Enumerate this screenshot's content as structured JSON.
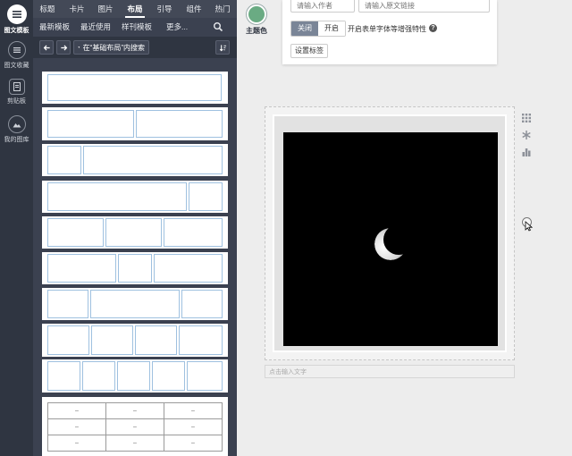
{
  "rail": {
    "items": [
      {
        "label": "图文模板",
        "icon": "menu-icon",
        "active": true
      },
      {
        "label": "图文收藏",
        "icon": "list-icon",
        "active": false
      },
      {
        "label": "剪贴板",
        "icon": "clipboard-icon",
        "active": false
      },
      {
        "label": "我的图库",
        "icon": "image-icon",
        "active": false
      }
    ]
  },
  "topnav": {
    "tabs": [
      "标题",
      "卡片",
      "图片",
      "布局",
      "引导",
      "组件",
      "热门"
    ],
    "active": "布局"
  },
  "subnav": {
    "tabs": [
      "最新模板",
      "最近使用",
      "样刊模板",
      "更多..."
    ]
  },
  "toolbar": {
    "search_label": "在“基础布局”内搜索"
  },
  "table_template": {
    "cells": [
      "–",
      "–",
      "–",
      "–",
      "–",
      "–",
      "–",
      "–",
      "–"
    ]
  },
  "theme": {
    "label": "主题色",
    "color": "#6aab83"
  },
  "settings": {
    "author_placeholder": "请输入作者",
    "link_placeholder": "请输入原文链接",
    "toggle_off": "关闭",
    "toggle_on": "开启",
    "option_label": "开启表单字体等增强特性",
    "tag_button": "设置标签"
  },
  "canvas": {
    "caption_placeholder": "点击输入文字"
  }
}
